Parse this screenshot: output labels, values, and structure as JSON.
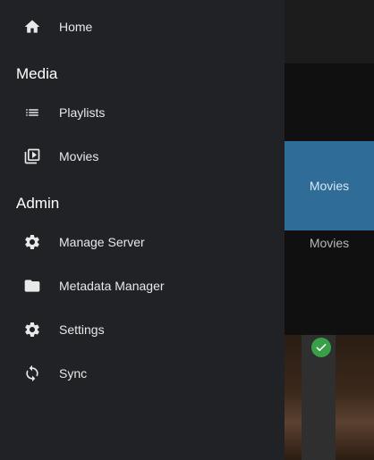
{
  "drawer": {
    "home": {
      "label": "Home",
      "icon": "home-icon"
    },
    "sections": [
      {
        "title": "Media",
        "items": [
          {
            "label": "Playlists",
            "icon": "list-icon"
          },
          {
            "label": "Movies",
            "icon": "video-library-icon"
          }
        ]
      },
      {
        "title": "Admin",
        "items": [
          {
            "label": "Manage Server",
            "icon": "gear-icon"
          },
          {
            "label": "Metadata Manager",
            "icon": "folder-icon"
          },
          {
            "label": "Settings",
            "icon": "gear-icon"
          },
          {
            "label": "Sync",
            "icon": "sync-icon"
          }
        ]
      }
    ]
  },
  "background": {
    "library_card_title": "Movies",
    "library_card_label": "Movies",
    "card_color": "#2f6c97",
    "played_badge_icon": "check-icon",
    "played_badge_color": "#3aa047"
  }
}
